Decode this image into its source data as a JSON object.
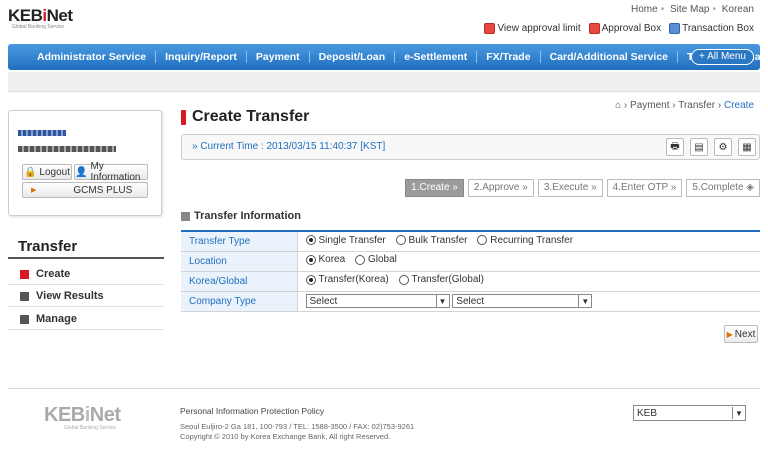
{
  "header": {
    "logo": "KEBiNet",
    "logo_sub": "Global Banking Service",
    "top_links": [
      "Home",
      "Site Map",
      "Korean"
    ],
    "utility_links": [
      "View approval limit",
      "Approval Box",
      "Transaction Box"
    ]
  },
  "nav": {
    "items": [
      "Administrator Service",
      "Inquiry/Report",
      "Payment",
      "Deposit/Loan",
      "e-Settlement",
      "FX/Trade",
      "Card/Additional Service",
      "Treasury Management"
    ],
    "all_menu": "+ All Menu"
  },
  "userbox": {
    "logout": "Logout",
    "my_info": "My Information",
    "gcms": "GCMS PLUS"
  },
  "sidebar": {
    "title": "Transfer",
    "items": [
      "Create",
      "View Results",
      "Manage"
    ]
  },
  "breadcrumb": [
    "Payment",
    "Transfer",
    "Create"
  ],
  "page": {
    "title": "Create Transfer",
    "current_time": "» Current Time : 2013/03/15 11:40:37 [KST]"
  },
  "steps": [
    "1.Create »",
    "2.Approve »",
    "3.Execute »",
    "4.Enter OTP »",
    "5.Complete"
  ],
  "section": {
    "title": "Transfer Information"
  },
  "form": {
    "transfer_type": {
      "label": "Transfer Type",
      "options": [
        "Single Transfer",
        "Bulk Transfer",
        "Recurring Transfer"
      ],
      "selected": "Single Transfer"
    },
    "location": {
      "label": "Location",
      "options": [
        "Korea",
        "Global"
      ],
      "selected": "Korea"
    },
    "korea_global": {
      "label": "Korea/Global",
      "options": [
        "Transfer(Korea)",
        "Transfer(Global)"
      ],
      "selected": "Transfer(Korea)"
    },
    "company_type": {
      "label": "Company Type",
      "select1": "Select",
      "select2": "Select"
    }
  },
  "next_label": "Next",
  "footer": {
    "logo": "KEBiNet",
    "logo_sub": "Global Banking Service",
    "privacy": "Personal Information Protection Policy",
    "address": "Seoul Euljiro-2 Ga 181, 100-793  /  TEL: 1588-3500  /  FAX: 02)753-9261",
    "copyright": "Copyright © 2010 by Korea Exchange Bank, All right Reserved.",
    "site_select": "KEB"
  },
  "colors": {
    "accent": "#1f6fbf",
    "brand_red": "#d71920"
  }
}
